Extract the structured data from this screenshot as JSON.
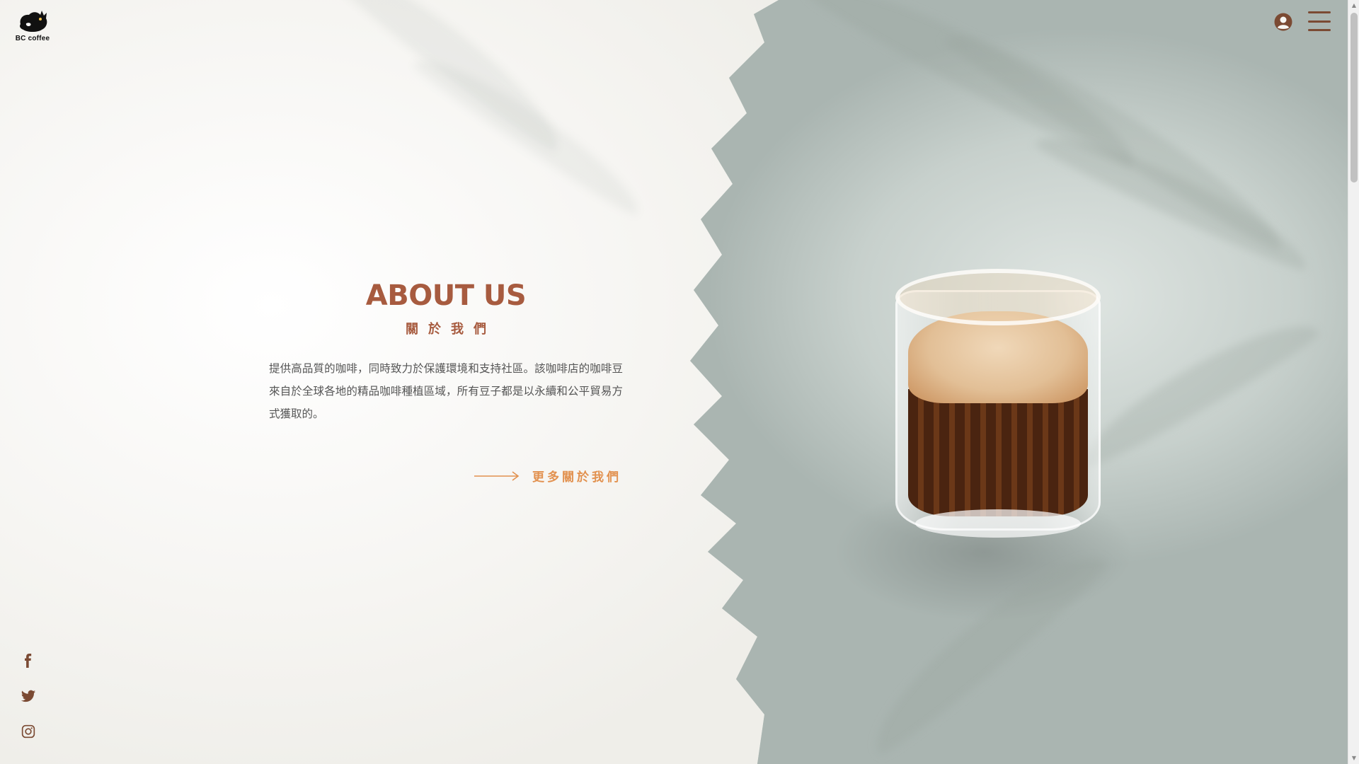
{
  "brand": {
    "name": "BC coffee"
  },
  "header": {
    "user_icon": "user-circle-icon",
    "menu_icon": "hamburger-menu-icon"
  },
  "about": {
    "title": "ABOUT US",
    "subtitle": "關於我們",
    "description": "提供高品質的咖啡，同時致力於保護環境和支持社區。該咖啡店的咖啡豆來自於全球各地的精品咖啡種植區域，所有豆子都是以永續和公平貿易方式獲取的。",
    "more_label": "更多關於我們"
  },
  "social": [
    {
      "name": "facebook",
      "icon": "facebook-icon"
    },
    {
      "name": "twitter",
      "icon": "twitter-icon"
    },
    {
      "name": "instagram",
      "icon": "instagram-icon"
    }
  ],
  "colors": {
    "accent_brown": "#a75b3f",
    "link_orange": "#e2914f",
    "icon_brown": "#7b4a33"
  }
}
